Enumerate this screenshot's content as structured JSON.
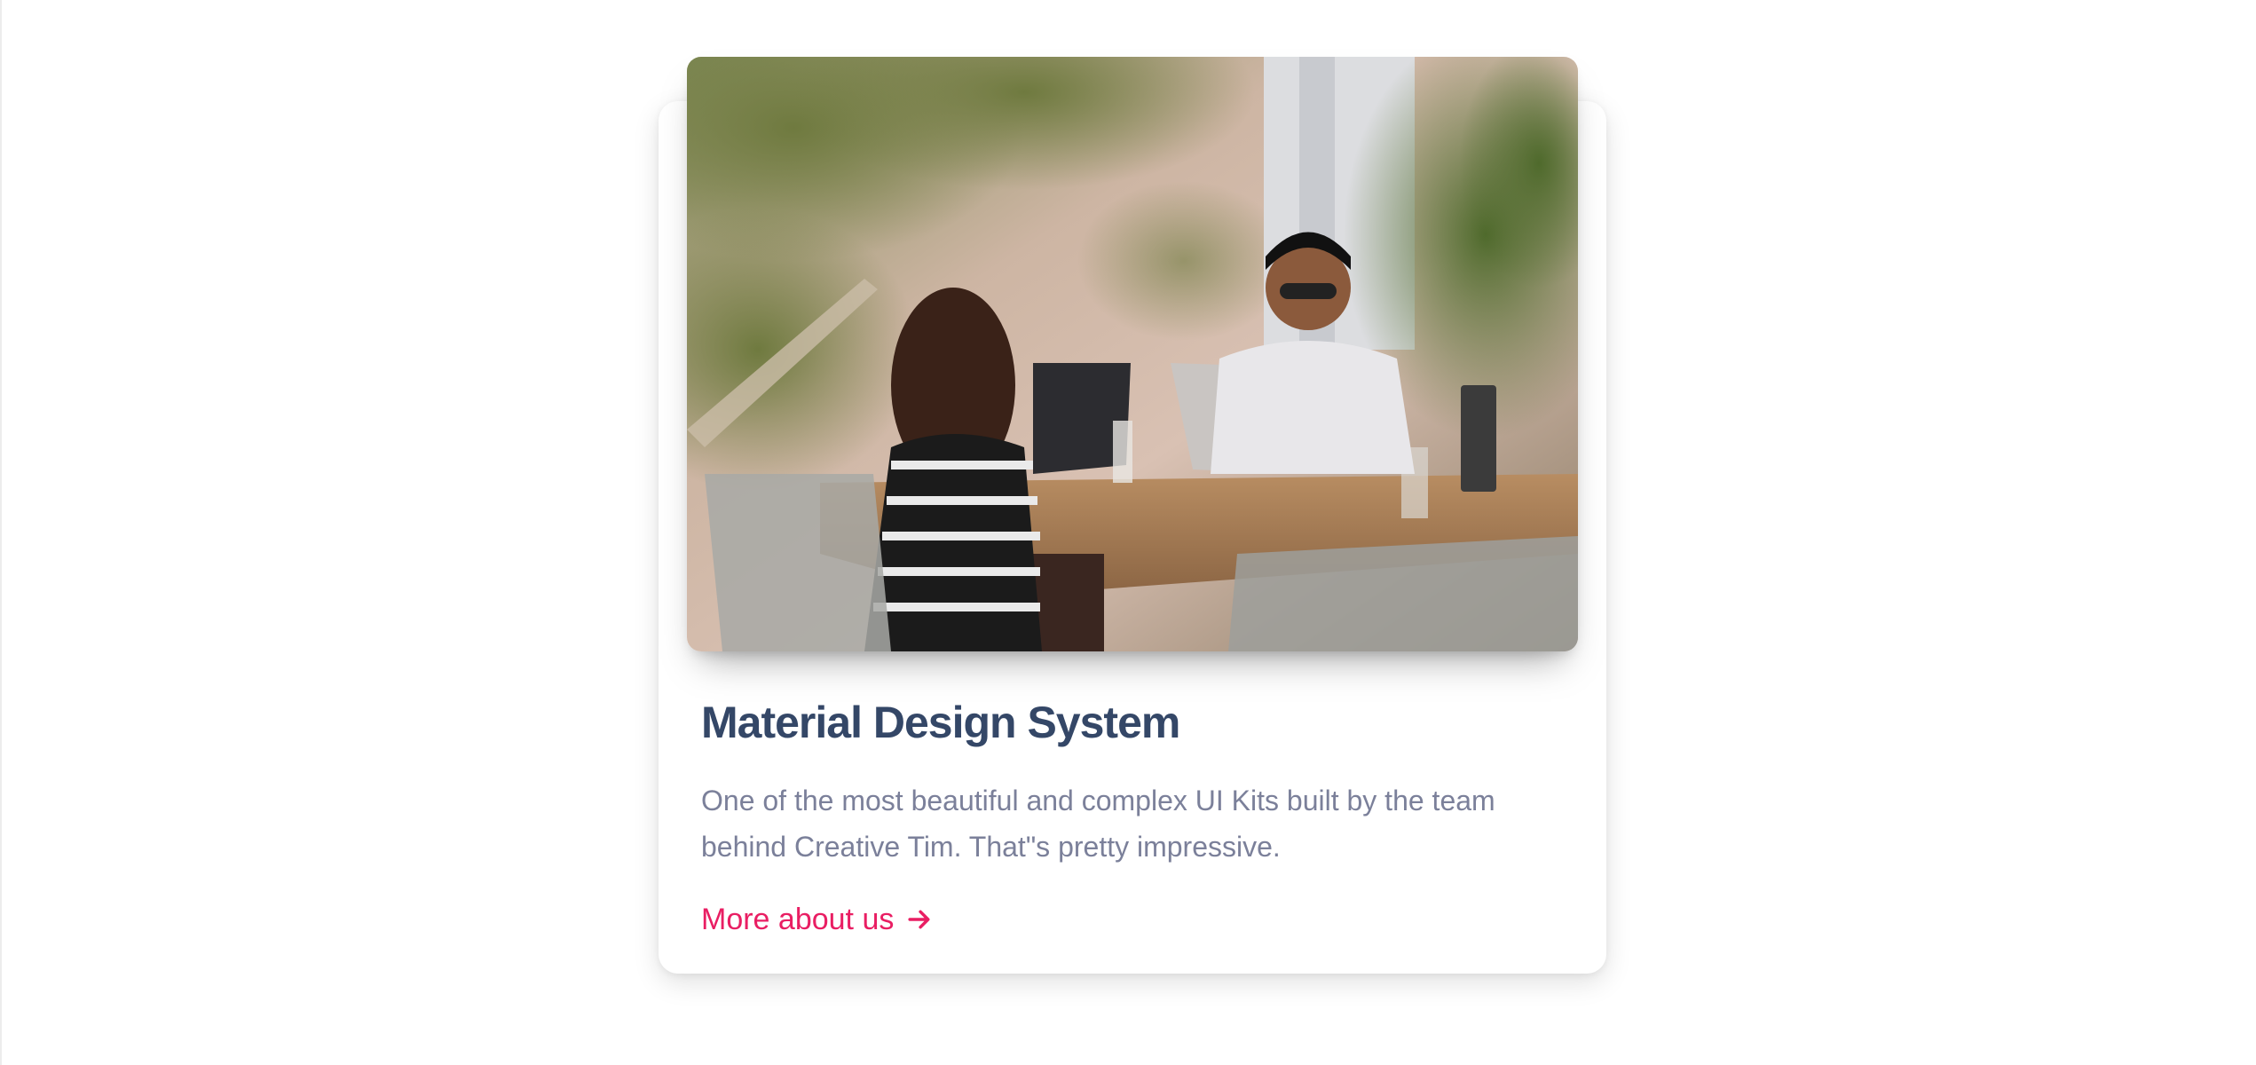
{
  "card": {
    "image_alt": "Two people working on laptops at an outdoor table",
    "title": "Material Design System",
    "description": "One of the most beautiful and complex UI Kits built by the team behind Creative Tim. That\"s pretty impressive.",
    "link_label": "More about us",
    "link_icon": "arrow-right-icon"
  },
  "colors": {
    "title": "#344767",
    "text": "#7b809a",
    "link": "#e91e63",
    "background": "#ffffff"
  }
}
